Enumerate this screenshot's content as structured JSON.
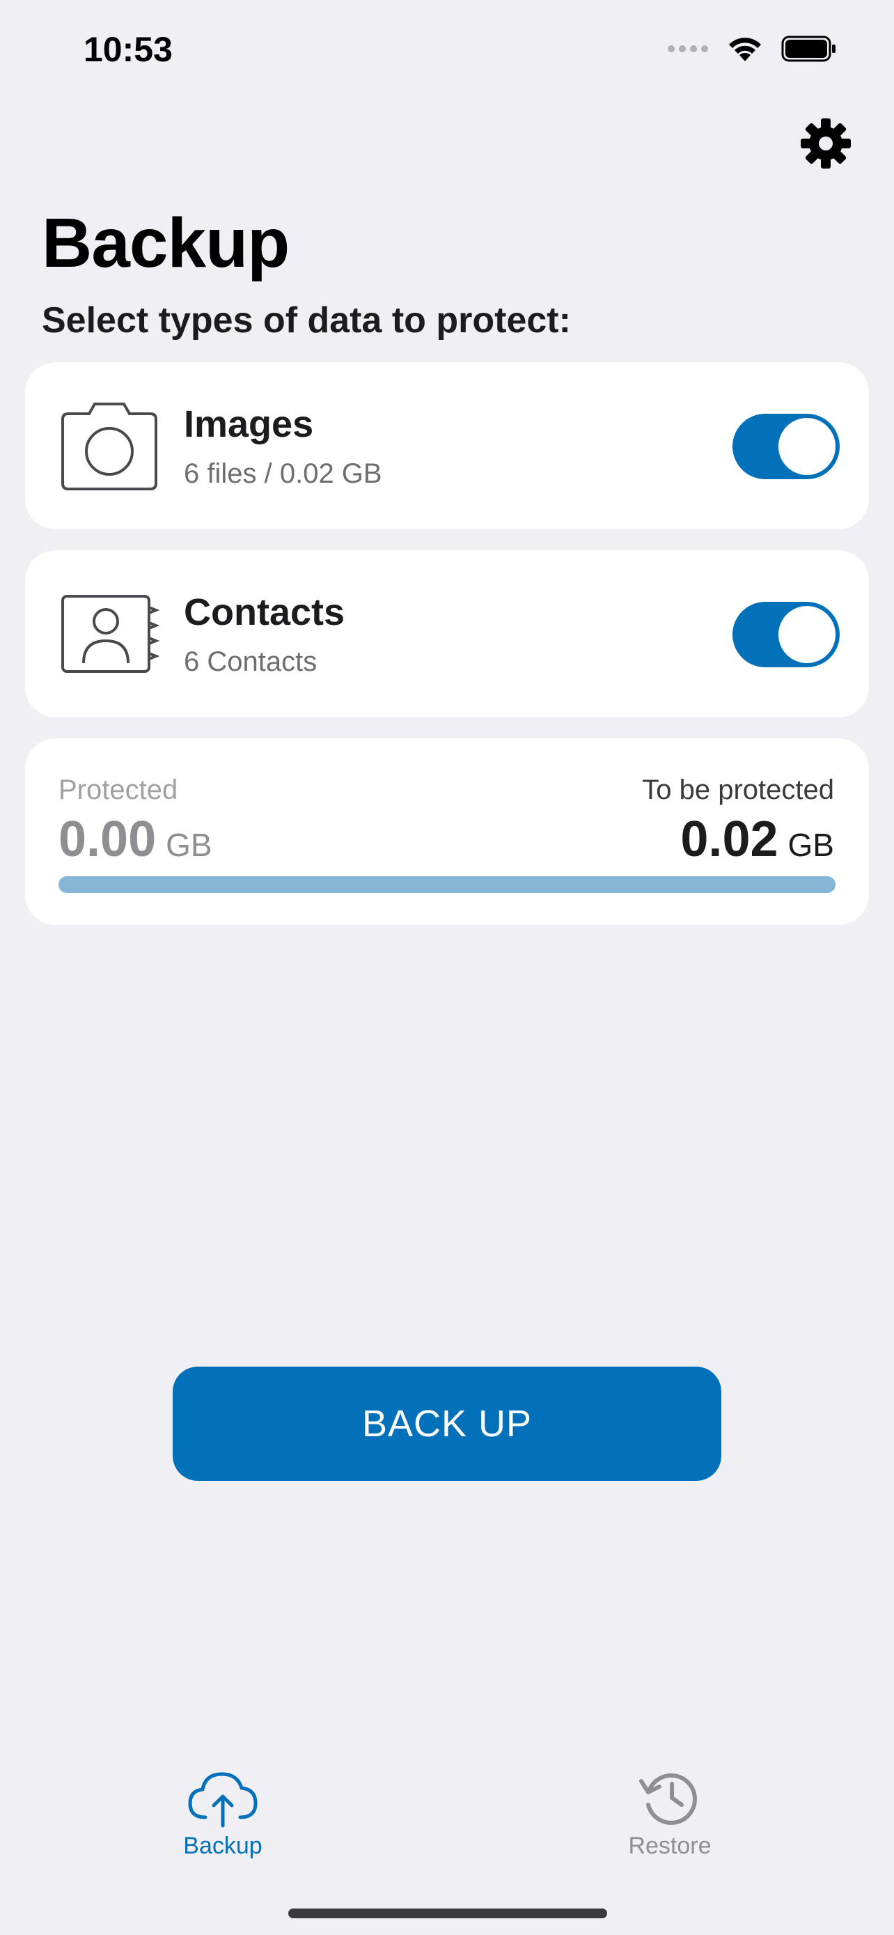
{
  "status_bar": {
    "time": "10:53",
    "icons": [
      "signal-dots-icon",
      "wifi-icon",
      "battery-icon"
    ]
  },
  "header": {
    "title": "Backup",
    "subtitle": "Select types of data to protect:",
    "settings_icon": "gear-icon"
  },
  "items": [
    {
      "title": "Images",
      "subtitle": "6 files / 0.02 GB",
      "icon": "camera-icon",
      "enabled": true
    },
    {
      "title": "Contacts",
      "subtitle": "6 Contacts",
      "icon": "contact-book-icon",
      "enabled": true
    }
  ],
  "progress": {
    "protected_label": "Protected",
    "protected_value": "0.00",
    "protected_unit": "GB",
    "pending_label": "To be protected",
    "pending_value": "0.02",
    "pending_unit": "GB",
    "fraction_protected": 0.0
  },
  "action": {
    "backup_label": "BACK UP"
  },
  "tabs": [
    {
      "label": "Backup",
      "icon": "cloud-upload-icon",
      "active": true
    },
    {
      "label": "Restore",
      "icon": "history-icon",
      "active": false
    }
  ],
  "colors": {
    "accent": "#0271b9",
    "background": "#efeff4",
    "progress_track": "#86b6d6",
    "inactive": "#8e8e93"
  }
}
